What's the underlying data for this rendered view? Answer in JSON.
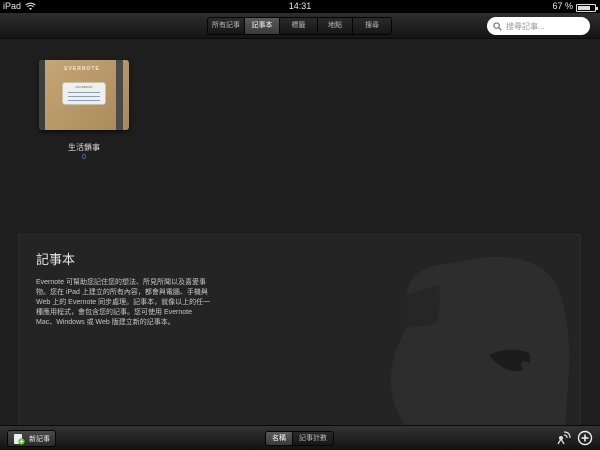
{
  "status_bar": {
    "device": "iPad",
    "time": "14:31",
    "battery": "67 %"
  },
  "top_tabs": [
    {
      "label": "所有記事",
      "active": false
    },
    {
      "label": "記事本",
      "active": true
    },
    {
      "label": "標籤",
      "active": false
    },
    {
      "label": "地點",
      "active": false
    },
    {
      "label": "搜尋",
      "active": false
    }
  ],
  "search": {
    "placeholder": "搜尋記事..."
  },
  "notebooks": [
    {
      "brand": "EVERNOTE",
      "label_text": "NOTEBOOK",
      "title": "生活鎖事",
      "count": "0"
    }
  ],
  "info_panel": {
    "title": "記事本",
    "text": "Evernote 可幫助您記住您的想法、所見所聞以及喜愛事物。您在 iPad 上建立的所有內容，都會與電腦、手機與 Web 上的 Evernote 同步處理。記事本，就像以上的任一種應用程式，會包含您的記事。您可使用 Evernote Mac、Windows 或 Web 版建立新的記事本。"
  },
  "bottom_bar": {
    "new_note_label": "新記事",
    "sort_tabs": [
      {
        "label": "名稱",
        "active": true
      },
      {
        "label": "記事計數",
        "active": false
      }
    ]
  },
  "icons": [
    "wifi-icon",
    "battery-icon",
    "search-icon",
    "new-note-icon",
    "sync-icon",
    "add-icon",
    "elephant-watermark-icon"
  ]
}
